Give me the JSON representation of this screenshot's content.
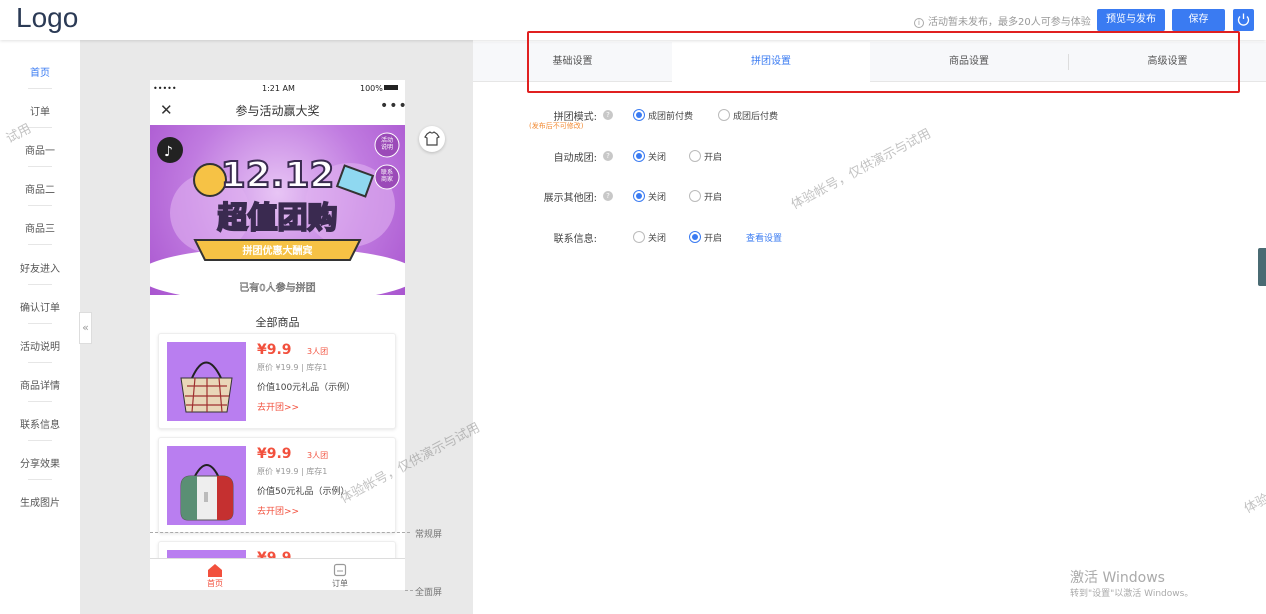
{
  "header": {
    "logo": "Logo",
    "notice": "活动暂未发布，最多20人可参与体验",
    "publish_label": "预览与发布",
    "save_label": "保存"
  },
  "sidebar": {
    "items": [
      {
        "label": "首页",
        "active": true
      },
      {
        "label": "订单"
      },
      {
        "label": "商品一"
      },
      {
        "label": "商品二"
      },
      {
        "label": "商品三"
      },
      {
        "label": "好友进入"
      },
      {
        "label": "确认订单"
      },
      {
        "label": "活动说明"
      },
      {
        "label": "商品详情"
      },
      {
        "label": "联系信息"
      },
      {
        "label": "分享效果"
      },
      {
        "label": "生成图片"
      }
    ],
    "collapse_glyph": "«"
  },
  "phone": {
    "status": {
      "dots": "•••••",
      "time": "1:21 AM",
      "battery": "100%"
    },
    "title": "参与活动赢大奖",
    "banner": {
      "headline": "12.12",
      "sub_headline": "超值团购",
      "ribbon": "拼团优惠大酬宾",
      "count": "已有0人参与拼团",
      "btn_rules": "活动说明",
      "btn_contact": "联系商家"
    },
    "goods_title": "全部商品",
    "products": [
      {
        "price": "¥9.9",
        "group": "3人团",
        "orig": "原价 ¥19.9 | 库存1",
        "desc": "价值100元礼品（示例）",
        "cta": "去开团>>"
      },
      {
        "price": "¥9.9",
        "group": "3人团",
        "orig": "原价 ¥19.9 | 库存1",
        "desc": "价值50元礼品（示例）",
        "cta": "去开团>>"
      },
      {
        "price": "¥9.9"
      }
    ],
    "tabbar": {
      "home": "首页",
      "orders": "订单"
    }
  },
  "screen_labels": {
    "normal": "常规屏",
    "full": "全面屏"
  },
  "tabs": [
    {
      "label": "基础设置"
    },
    {
      "label": "拼团设置",
      "active": true
    },
    {
      "label": "商品设置"
    },
    {
      "label": "高级设置"
    }
  ],
  "form": {
    "mode": {
      "label": "拼团模式:",
      "note": "(发布后不可修改)",
      "opt1": "成团前付费",
      "opt2": "成团后付费",
      "selected": 1
    },
    "auto": {
      "label": "自动成团:",
      "opt1": "关闭",
      "opt2": "开启",
      "selected": 1
    },
    "show_other": {
      "label": "展示其他团:",
      "opt1": "关闭",
      "opt2": "开启",
      "selected": 1
    },
    "contact": {
      "label": "联系信息:",
      "opt1": "关闭",
      "opt2": "开启",
      "selected": 2,
      "link": "查看设置"
    }
  },
  "watermark": "体验帐号，仅供演示与试用",
  "watermark_short": "体验帐号",
  "watermark_edge": "试用",
  "windows": {
    "title": "激活 Windows",
    "sub": "转到\"设置\"以激活 Windows。"
  },
  "colors": {
    "accent": "#3a7bf2",
    "price": "#f2503d",
    "highlight_box": "#e02020"
  }
}
